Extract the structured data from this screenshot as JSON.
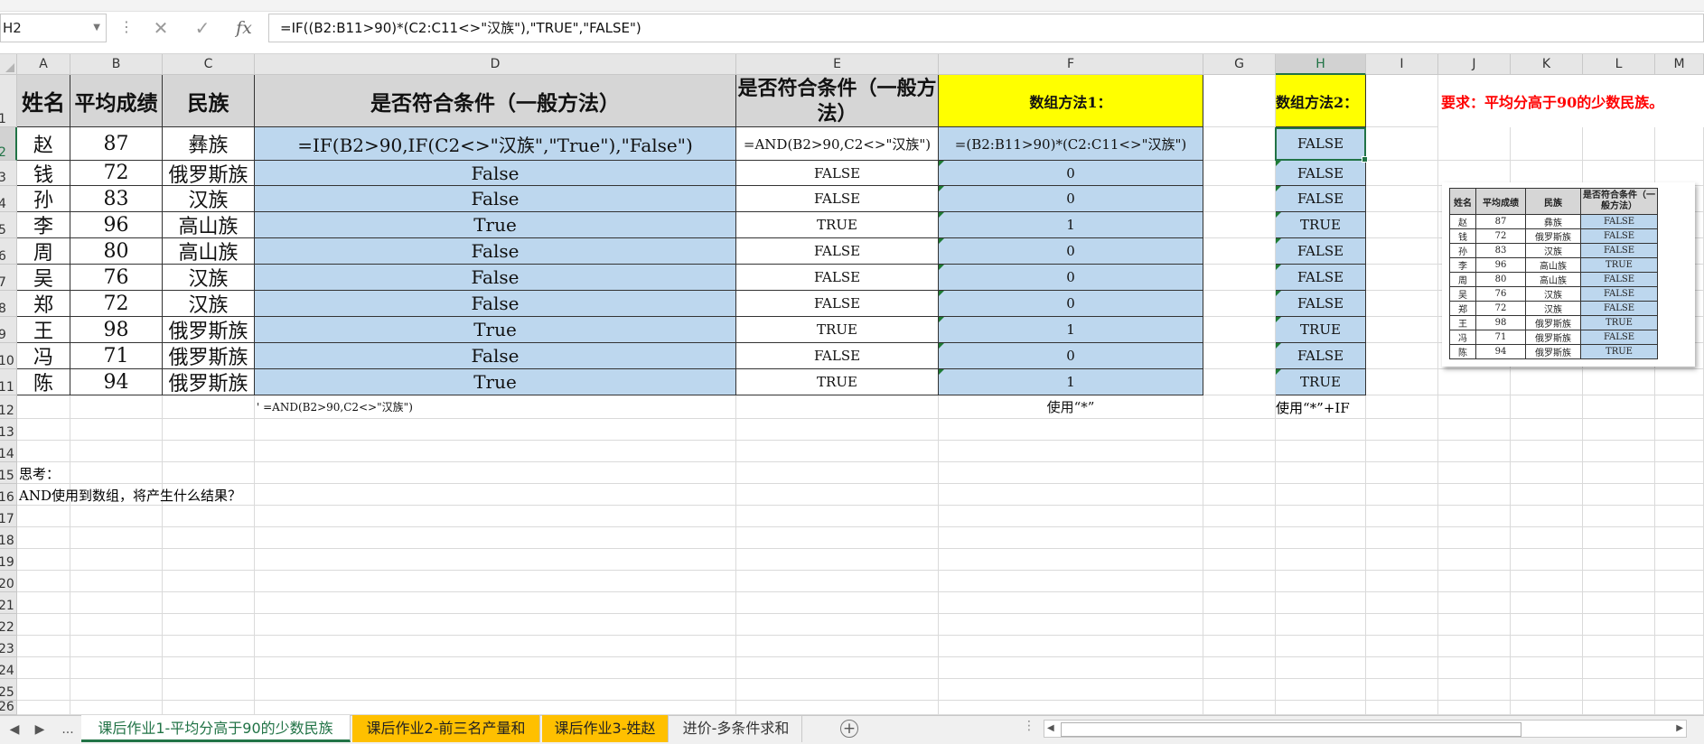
{
  "formula_bar": {
    "cell_ref": "H2",
    "formula": "=IF((B2:B11>90)*(C2:C11<>\"汉族\"),\"TRUE\",\"FALSE\")",
    "cancel_icon": "✕",
    "enter_icon": "✓",
    "fx_label": "fx"
  },
  "columns": [
    "A",
    "B",
    "C",
    "D",
    "E",
    "F",
    "G",
    "H",
    "I",
    "J",
    "K",
    "L",
    "M"
  ],
  "rows": [
    "1",
    "2",
    "3",
    "4",
    "5",
    "6",
    "7",
    "8",
    "9",
    "10",
    "11",
    "12",
    "13",
    "14",
    "15",
    "16",
    "17",
    "18",
    "19",
    "20",
    "21",
    "22",
    "23",
    "24",
    "25",
    "26"
  ],
  "headers": {
    "name": "姓名",
    "avg": "平均成绩",
    "ethnic": "民族",
    "d": "是否符合条件（一般方法）",
    "e": "是否符合条件（一般方法）",
    "f": "数组方法1：",
    "h": "数组方法2：",
    "requirement": "要求：平均分高于90的少数民族。"
  },
  "row2_formulas": {
    "d": "=IF(B2>90,IF(C2<>\"汉族\",\"True\"),\"False\")",
    "e": "=AND(B2>90,C2<>\"汉族\")",
    "f": "=(B2:B11>90)*(C2:C11<>\"汉族\")",
    "h": "FALSE"
  },
  "data_rows": [
    {
      "name": "赵",
      "avg": "87",
      "ethnic": "彝族",
      "d": "",
      "e": "",
      "f": "",
      "h": "FALSE"
    },
    {
      "name": "钱",
      "avg": "72",
      "ethnic": "俄罗斯族",
      "d": "False",
      "e": "FALSE",
      "f": "0",
      "h": "FALSE"
    },
    {
      "name": "孙",
      "avg": "83",
      "ethnic": "汉族",
      "d": "False",
      "e": "FALSE",
      "f": "0",
      "h": "FALSE"
    },
    {
      "name": "李",
      "avg": "96",
      "ethnic": "高山族",
      "d": "True",
      "e": "TRUE",
      "f": "1",
      "h": "TRUE"
    },
    {
      "name": "周",
      "avg": "80",
      "ethnic": "高山族",
      "d": "False",
      "e": "FALSE",
      "f": "0",
      "h": "FALSE"
    },
    {
      "name": "吴",
      "avg": "76",
      "ethnic": "汉族",
      "d": "False",
      "e": "FALSE",
      "f": "0",
      "h": "FALSE"
    },
    {
      "name": "郑",
      "avg": "72",
      "ethnic": "汉族",
      "d": "False",
      "e": "FALSE",
      "f": "0",
      "h": "FALSE"
    },
    {
      "name": "王",
      "avg": "98",
      "ethnic": "俄罗斯族",
      "d": "True",
      "e": "TRUE",
      "f": "1",
      "h": "TRUE"
    },
    {
      "name": "冯",
      "avg": "71",
      "ethnic": "俄罗斯族",
      "d": "False",
      "e": "FALSE",
      "f": "0",
      "h": "FALSE"
    },
    {
      "name": "陈",
      "avg": "94",
      "ethnic": "俄罗斯族",
      "d": "True",
      "e": "TRUE",
      "f": "1",
      "h": "TRUE"
    }
  ],
  "notes": {
    "d12": "' =AND(B2>90,C2<>\"汉族\")",
    "f12": "使用“*”",
    "h12": "使用“*”+IF",
    "a15": "思考：",
    "a16": "AND使用到数组，将产生什么结果？"
  },
  "thumbnail": {
    "headers": [
      "姓名",
      "平均成绩",
      "民族",
      "是否符合条件（一般方法）"
    ],
    "rows": [
      [
        "赵",
        "87",
        "彝族",
        "FALSE"
      ],
      [
        "钱",
        "72",
        "俄罗斯族",
        "FALSE"
      ],
      [
        "孙",
        "83",
        "汉族",
        "FALSE"
      ],
      [
        "李",
        "96",
        "高山族",
        "TRUE"
      ],
      [
        "周",
        "80",
        "高山族",
        "FALSE"
      ],
      [
        "吴",
        "76",
        "汉族",
        "FALSE"
      ],
      [
        "郑",
        "72",
        "汉族",
        "FALSE"
      ],
      [
        "王",
        "98",
        "俄罗斯族",
        "TRUE"
      ],
      [
        "冯",
        "71",
        "俄罗斯族",
        "FALSE"
      ],
      [
        "陈",
        "94",
        "俄罗斯族",
        "TRUE"
      ]
    ]
  },
  "sheet_tabs": [
    {
      "label": "课后作业1-平均分高于90的少数民族",
      "state": "active"
    },
    {
      "label": "课后作业2-前三名产量和",
      "state": "orange"
    },
    {
      "label": "课后作业3-姓赵",
      "state": "orange"
    },
    {
      "label": "进价-多条件求和",
      "state": "plain"
    }
  ],
  "tab_nav": {
    "prev": "◀",
    "next": "▶",
    "more": "..."
  },
  "colors": {
    "accent": "#217346",
    "blue_fill": "#bdd7ee",
    "yellow_fill": "#ffff00",
    "orange_tab": "#ffc000",
    "red_text": "#ff0000"
  }
}
